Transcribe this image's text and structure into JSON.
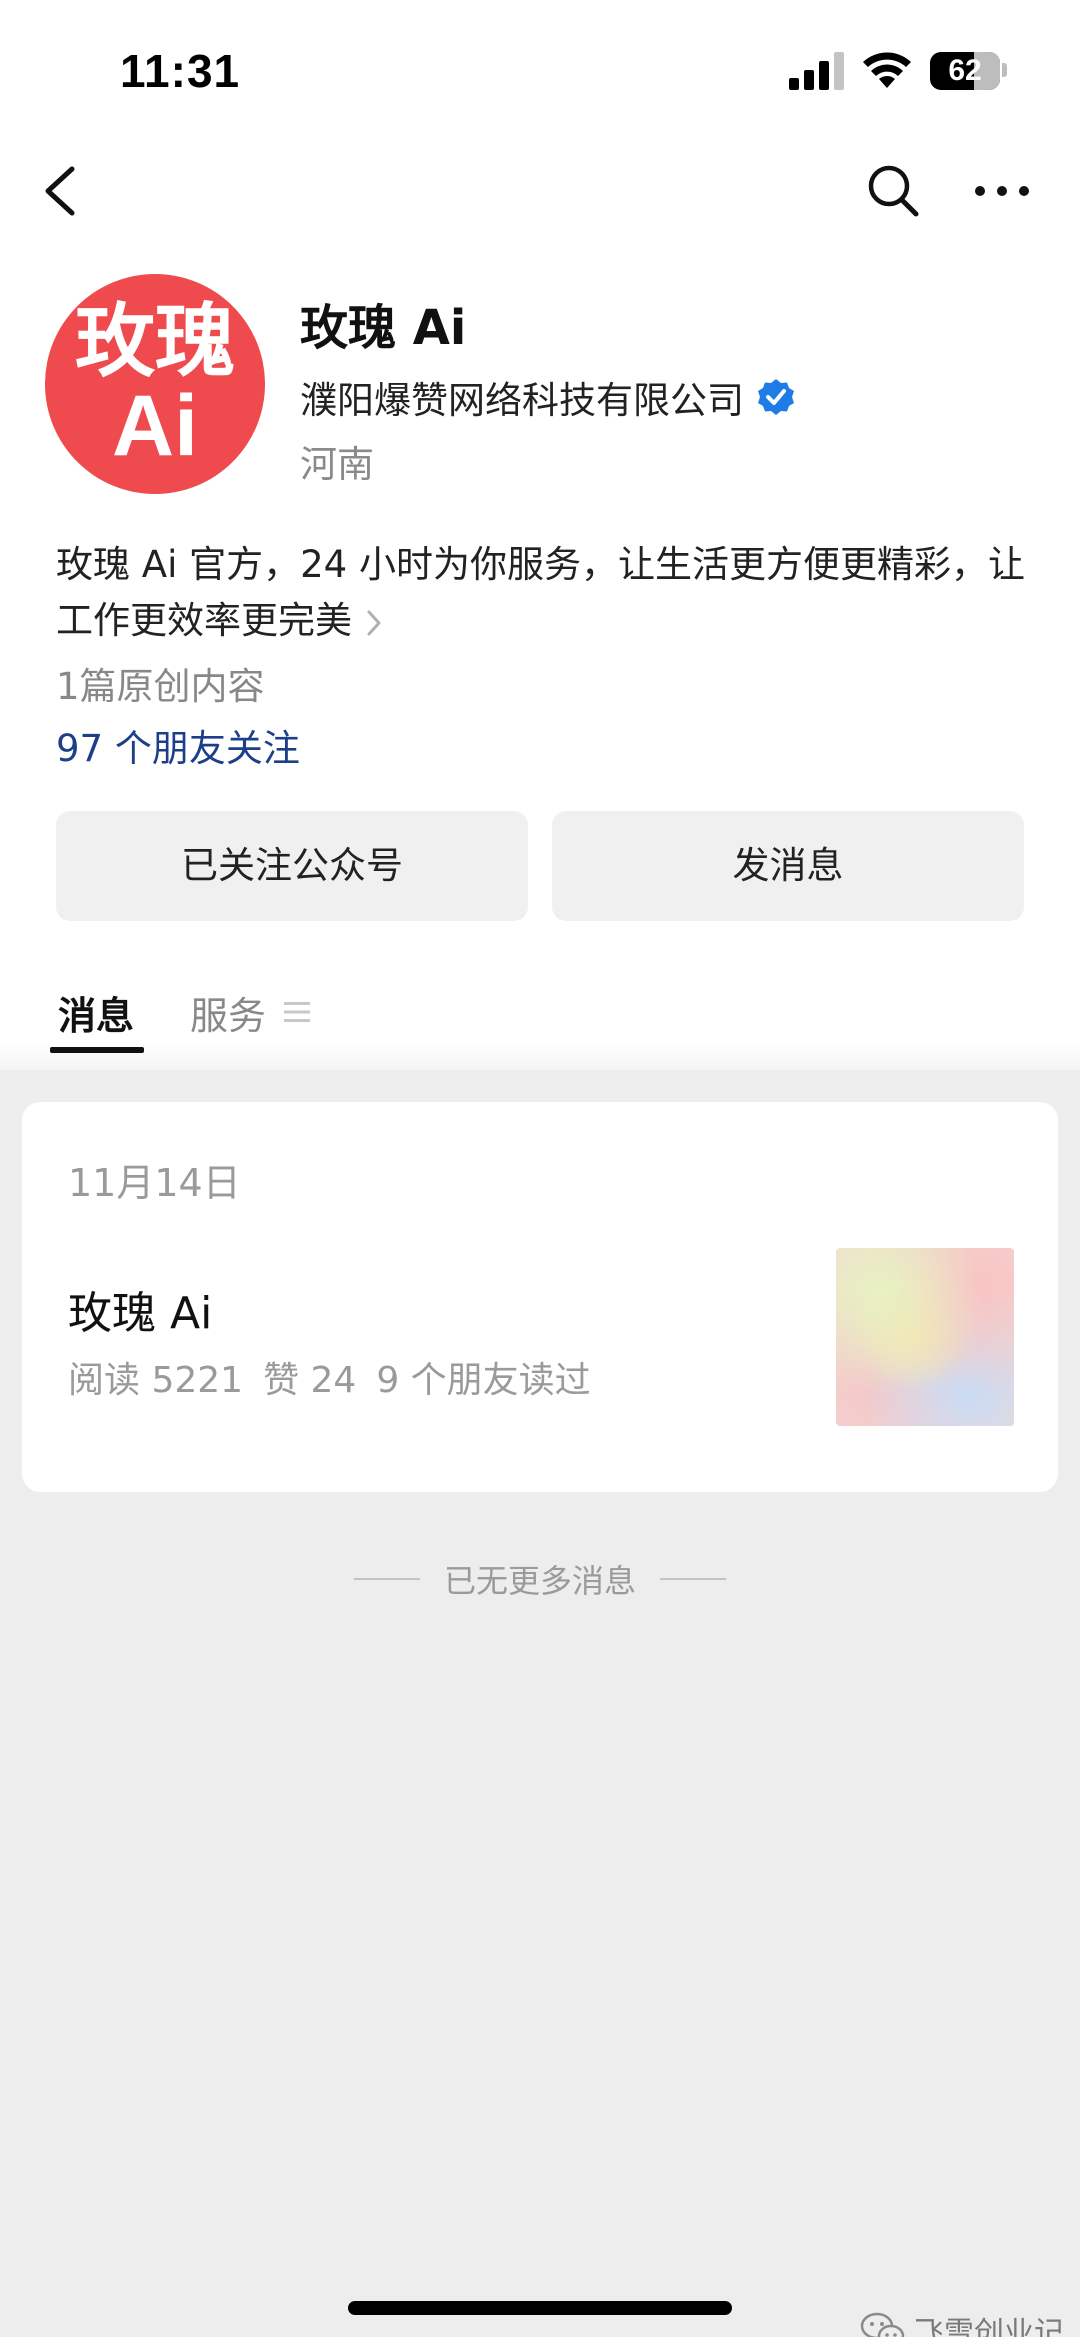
{
  "status_bar": {
    "time": "11:31",
    "battery": "62"
  },
  "nav": {
    "back_icon": "chevron-left-icon",
    "search_icon": "search-icon",
    "more_icon": "ellipsis-icon"
  },
  "profile": {
    "avatar_text_line1": "玫瑰",
    "avatar_text_line2": "Ai",
    "avatar_color": "#ef4b4e",
    "name": "玫瑰 Ai",
    "company": "濮阳爆赞网络科技有限公司",
    "verified_color": "#1e7ce6",
    "region": "河南",
    "intro": "玫瑰 Ai 官方，24 小时为你服务，让生活更方便更精彩，让工作更效率更完美",
    "original_count": "1篇原创内容",
    "friends_follow": "97 个朋友关注"
  },
  "actions": {
    "follow_label": "已关注公众号",
    "message_label": "发消息"
  },
  "tabs": [
    {
      "label": "消息",
      "active": true
    },
    {
      "label": "服务",
      "active": false
    }
  ],
  "messages": [
    {
      "date": "11月14日",
      "title": "玫瑰 Ai",
      "reads": "阅读 5221",
      "likes": "赞 24",
      "friends_read": "9 个朋友读过"
    }
  ],
  "end_text": "已无更多消息",
  "watermark": "飞雪创业记"
}
